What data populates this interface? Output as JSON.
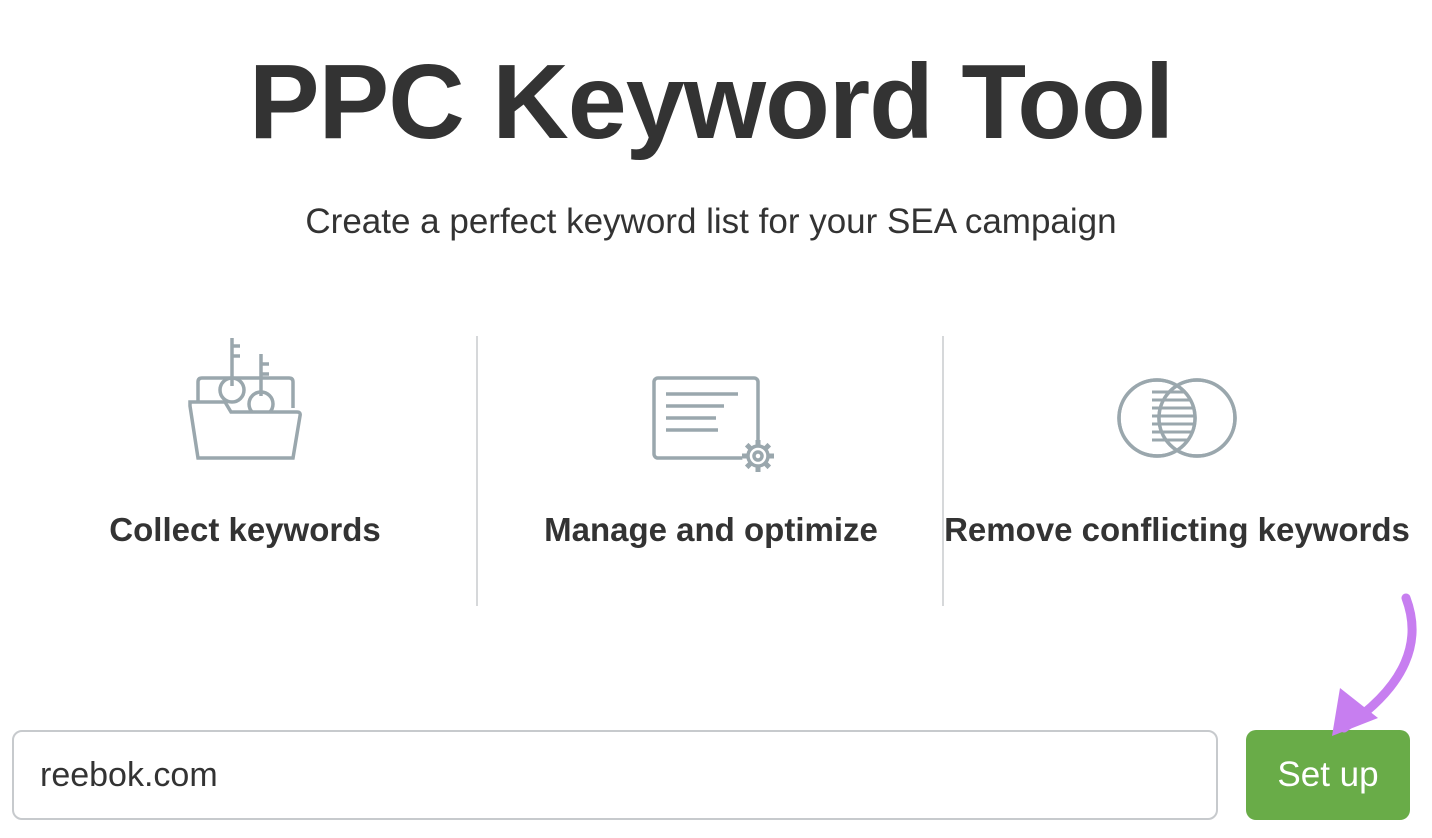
{
  "header": {
    "title": "PPC Keyword Tool",
    "subtitle": "Create a perfect keyword list for your SEA campaign"
  },
  "features": [
    {
      "label": "Collect keywords",
      "icon": "folder-keys-icon"
    },
    {
      "label": "Manage and optimize",
      "icon": "document-gear-icon"
    },
    {
      "label": "Remove conflicting keywords",
      "icon": "overlapping-circles-icon"
    }
  ],
  "form": {
    "domain_value": "reebok.com",
    "setup_label": "Set up"
  },
  "colors": {
    "text": "#333333",
    "icon": "#9aa7ad",
    "button": "#69ac48",
    "arrow": "#c77ef0"
  }
}
